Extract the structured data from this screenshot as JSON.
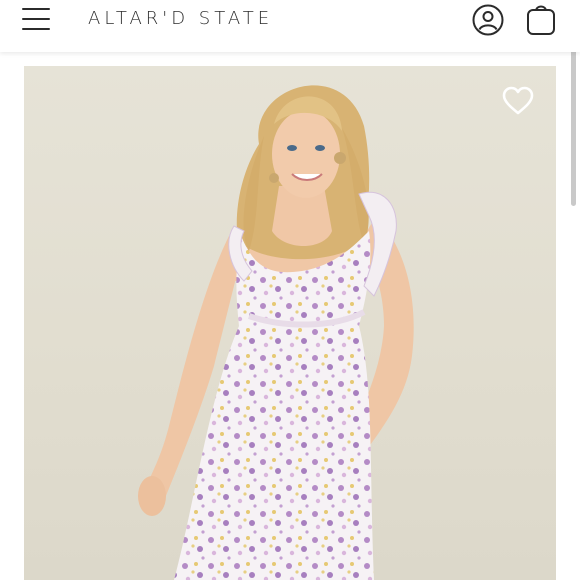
{
  "header": {
    "logo_text": "ALTAR'D STATE",
    "menu_icon": "hamburger-menu-icon",
    "account_icon": "user-account-icon",
    "bag_icon": "shopping-bag-icon"
  },
  "product": {
    "wishlist_icon": "heart-outline-icon"
  },
  "colors": {
    "background": "#ffffff",
    "icon": "#2b2b2b",
    "photo_backdrop": "#e3e0d3"
  }
}
